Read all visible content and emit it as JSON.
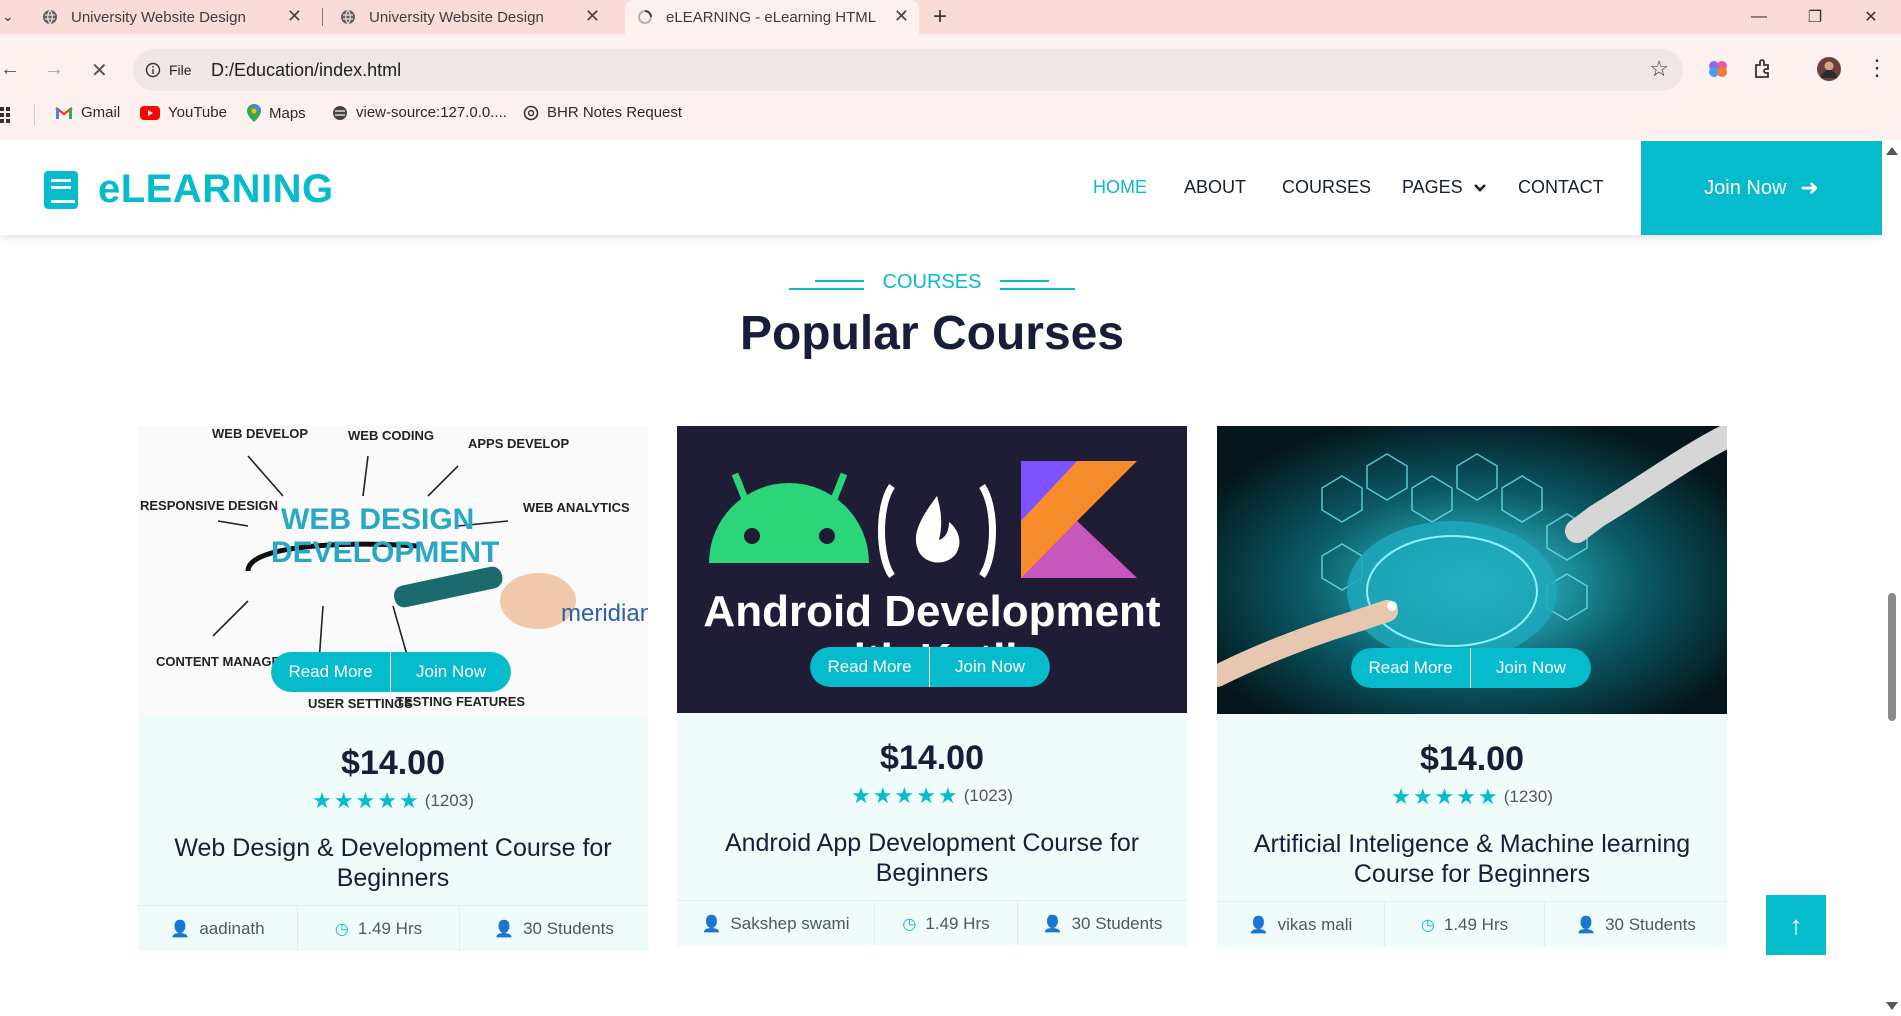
{
  "browser": {
    "tabs": [
      {
        "title": "University Website Design"
      },
      {
        "title": "University Website Design"
      },
      {
        "title": "eLEARNING - eLearning HTML T"
      }
    ],
    "new_tab_icon": "plus-icon",
    "address": {
      "scheme_label": "File",
      "url": "D:/Education/index.html"
    },
    "bookmarks": [
      {
        "label": "Gmail",
        "icon": "gmail-icon"
      },
      {
        "label": "YouTube",
        "icon": "youtube-icon"
      },
      {
        "label": "Maps",
        "icon": "maps-icon"
      },
      {
        "label": "view-source:127.0.0....",
        "icon": "globe-icon"
      },
      {
        "label": "BHR Notes Request",
        "icon": "openai-icon"
      }
    ]
  },
  "site": {
    "brand": "eLEARNING",
    "accent_color": "#06bbcc",
    "dark_color": "#181d38",
    "menu": [
      {
        "label": "HOME",
        "active": true
      },
      {
        "label": "ABOUT"
      },
      {
        "label": "COURSES"
      },
      {
        "label": "PAGES"
      },
      {
        "label": "CONTACT"
      }
    ],
    "join_label": "Join Now"
  },
  "section": {
    "tag": "COURSES",
    "title": "Popular Courses"
  },
  "courses": [
    {
      "image_text": [
        "WEB DESIGN",
        "DEVELOPMENT"
      ],
      "image_labels": [
        "WEB DEVELOP",
        "WEB CODING",
        "APPS DEVELOP",
        "RESPONSIVE DESIGN",
        "WEB ANALYTICS",
        "CONTENT MANAGEMENT",
        "USER SETTINGS",
        "TESTING FEATURES"
      ],
      "logo_text": "meridian",
      "read_more": "Read More",
      "join_now": "Join Now",
      "price": "$14.00",
      "stars": 5,
      "reviews": "(1203)",
      "title": "Web Design & Development Course for Beginners",
      "instructor": "aadinath",
      "duration": "1.49 Hrs",
      "students": "30 Students"
    },
    {
      "image_text": [
        "Android Development",
        "with Kotlin"
      ],
      "read_more": "Read More",
      "join_now": "Join Now",
      "price": "$14.00",
      "stars": 5,
      "reviews": "(1023)",
      "title": "Android App Development Course for Beginners",
      "instructor": "Sakshep swami",
      "duration": "1.49 Hrs",
      "students": "30 Students"
    },
    {
      "read_more": "Read More",
      "join_now": "Join Now",
      "price": "$14.00",
      "stars": 5,
      "reviews": "(1230)",
      "title": "Artificial Inteligence & Machine learning Course for Beginners",
      "instructor": "vikas mali",
      "duration": "1.49 Hrs",
      "students": "30 Students"
    }
  ]
}
